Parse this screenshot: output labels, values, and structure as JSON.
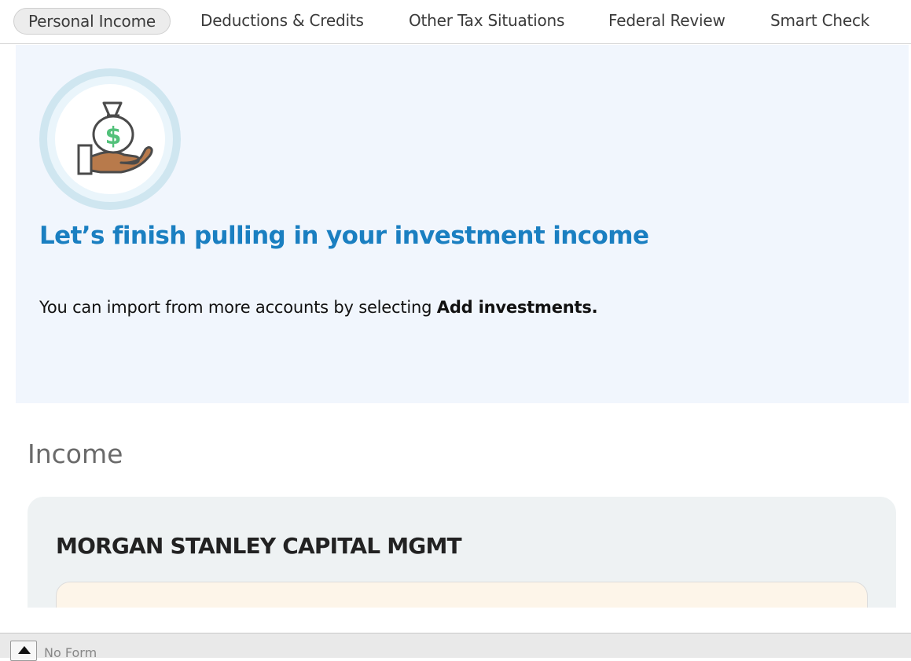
{
  "tabs": [
    {
      "label": "Personal Income",
      "active": true
    },
    {
      "label": "Deductions & Credits"
    },
    {
      "label": "Other Tax Situations"
    },
    {
      "label": "Federal Review"
    },
    {
      "label": "Smart Check"
    }
  ],
  "hero": {
    "icon": "money-bag-hand-icon",
    "title": "Let’s finish pulling in your investment income",
    "body_prefix": "You can import from more accounts by selecting ",
    "body_emphasis": "Add investments."
  },
  "income": {
    "section_title": "Income",
    "account_name": "MORGAN STANLEY CAPITAL MGMT"
  },
  "statusbar": {
    "label": "No Form",
    "button_icon": "caret-up-icon"
  },
  "colors": {
    "accent": "#1a7fc1",
    "hero_bg": "#f1f6fd",
    "card_bg": "#eef2f3",
    "inner_card_bg": "#fdf5e9"
  }
}
